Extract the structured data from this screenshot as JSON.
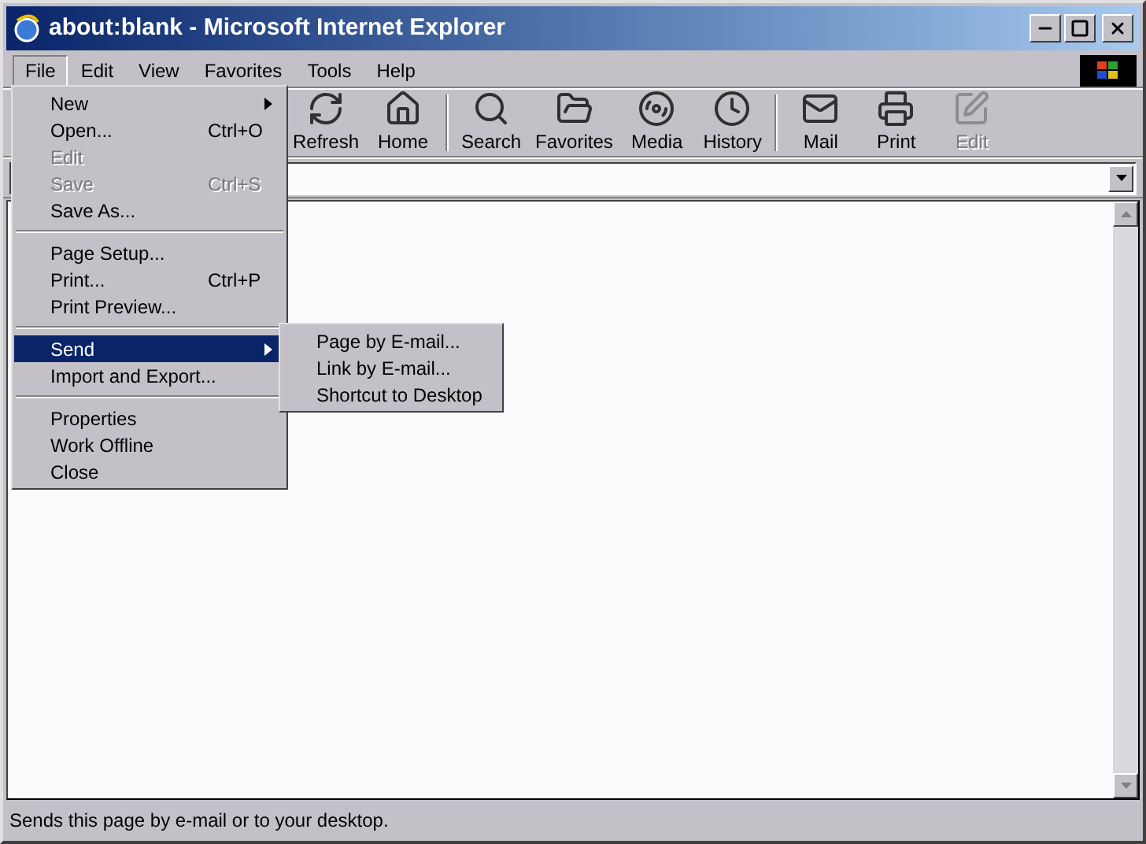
{
  "window": {
    "title": "about:blank - Microsoft Internet Explorer"
  },
  "menu_bar": [
    {
      "label": "File",
      "selected": true
    },
    {
      "label": "Edit",
      "selected": false
    },
    {
      "label": "View",
      "selected": false
    },
    {
      "label": "Favorites",
      "selected": false
    },
    {
      "label": "Tools",
      "selected": false
    },
    {
      "label": "Help",
      "selected": false
    }
  ],
  "toolbar": [
    {
      "kind": "refresh",
      "label": "Refresh",
      "disabled": false
    },
    {
      "kind": "home",
      "label": "Home",
      "disabled": false
    },
    {
      "kind": "separator"
    },
    {
      "kind": "search",
      "label": "Search",
      "disabled": false
    },
    {
      "kind": "favorites",
      "label": "Favorites",
      "disabled": false
    },
    {
      "kind": "media",
      "label": "Media",
      "disabled": false
    },
    {
      "kind": "history",
      "label": "History",
      "disabled": false
    },
    {
      "kind": "separator"
    },
    {
      "kind": "mail",
      "label": "Mail",
      "disabled": false
    },
    {
      "kind": "print",
      "label": "Print",
      "disabled": false
    },
    {
      "kind": "edit",
      "label": "Edit",
      "disabled": true
    }
  ],
  "file_menu": {
    "items": [
      {
        "kind": "item",
        "label": "New",
        "submenu": true,
        "disabled": false,
        "selected": false
      },
      {
        "kind": "item",
        "label": "Open...",
        "shortcut": "Ctrl+O",
        "submenu": false,
        "disabled": false,
        "selected": false
      },
      {
        "kind": "item",
        "label": "Edit",
        "submenu": false,
        "disabled": true,
        "selected": false
      },
      {
        "kind": "item",
        "label": "Save",
        "shortcut": "Ctrl+S",
        "submenu": false,
        "disabled": true,
        "selected": false
      },
      {
        "kind": "item",
        "label": "Save As...",
        "submenu": false,
        "disabled": false,
        "selected": false
      },
      {
        "kind": "separator"
      },
      {
        "kind": "item",
        "label": "Page Setup...",
        "submenu": false,
        "disabled": false,
        "selected": false
      },
      {
        "kind": "item",
        "label": "Print...",
        "shortcut": "Ctrl+P",
        "submenu": false,
        "disabled": false,
        "selected": false
      },
      {
        "kind": "item",
        "label": "Print Preview...",
        "submenu": false,
        "disabled": false,
        "selected": false
      },
      {
        "kind": "separator"
      },
      {
        "kind": "item",
        "label": "Send",
        "submenu": true,
        "disabled": false,
        "selected": true
      },
      {
        "kind": "item",
        "label": "Import and Export...",
        "submenu": false,
        "disabled": false,
        "selected": false
      },
      {
        "kind": "separator"
      },
      {
        "kind": "item",
        "label": "Properties",
        "submenu": false,
        "disabled": false,
        "selected": false
      },
      {
        "kind": "item",
        "label": "Work Offline",
        "submenu": false,
        "disabled": false,
        "selected": false
      },
      {
        "kind": "item",
        "label": "Close",
        "submenu": false,
        "disabled": false,
        "selected": false
      }
    ]
  },
  "send_submenu": {
    "items": [
      {
        "label": "Page by E-mail..."
      },
      {
        "label": "Link by E-mail..."
      },
      {
        "label": "Shortcut to Desktop"
      }
    ]
  },
  "status_bar": {
    "text": "Sends this page by e-mail or to your desktop."
  }
}
